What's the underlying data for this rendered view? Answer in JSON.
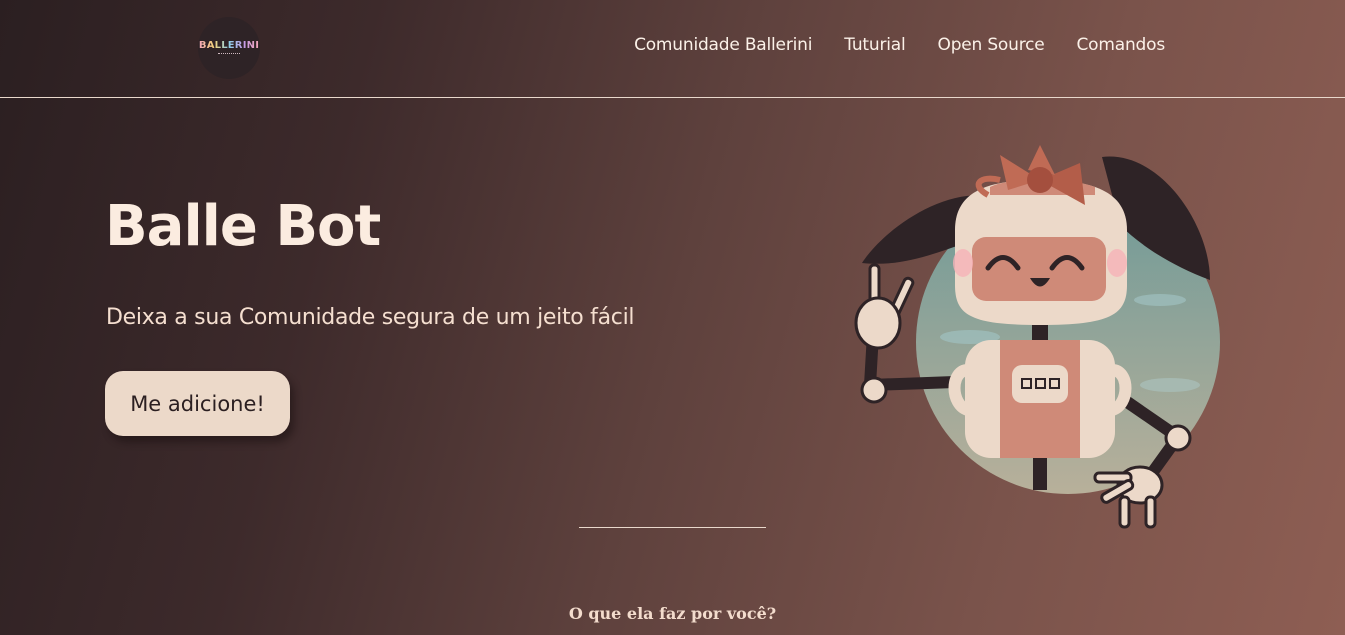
{
  "header": {
    "logo_text": "BALLERINI",
    "nav": [
      {
        "label": "Comunidade Ballerini"
      },
      {
        "label": "Tuturial"
      },
      {
        "label": "Open Source"
      },
      {
        "label": "Comandos"
      }
    ]
  },
  "hero": {
    "title": "Balle Bot",
    "subtitle": "Deixa a sua Comunidade segura de um jeito fácil",
    "cta_label": "Me adicione!",
    "illustration_icon": "robot-girl-illustration"
  },
  "section": {
    "title": "O que ela faz por você?"
  },
  "colors": {
    "bg_start": "#2b1f21",
    "bg_end": "#8e5e53",
    "cta_bg": "#ecd9c9",
    "text": "#fbece0"
  }
}
